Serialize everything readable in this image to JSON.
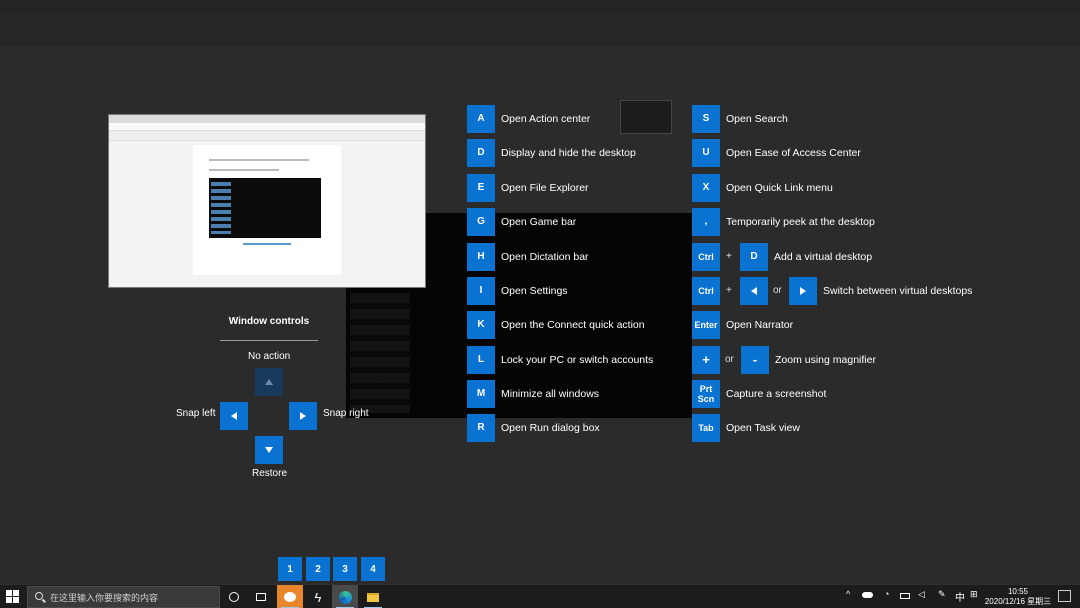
{
  "window_controls": {
    "title": "Window controls",
    "up_label": "No action",
    "left_label": "Snap left",
    "right_label": "Snap right",
    "down_label": "Restore"
  },
  "shortcuts_left": [
    {
      "key": "A",
      "desc": "Open Action center"
    },
    {
      "key": "D",
      "desc": "Display and hide the desktop"
    },
    {
      "key": "E",
      "desc": "Open File Explorer"
    },
    {
      "key": "G",
      "desc": "Open Game bar"
    },
    {
      "key": "H",
      "desc": "Open Dictation bar"
    },
    {
      "key": "I",
      "desc": "Open Settings"
    },
    {
      "key": "K",
      "desc": "Open the Connect quick action"
    },
    {
      "key": "L",
      "desc": "Lock your PC or switch accounts"
    },
    {
      "key": "M",
      "desc": "Minimize all windows"
    },
    {
      "key": "R",
      "desc": "Open Run dialog box"
    }
  ],
  "shortcuts_right": [
    {
      "key": "S",
      "desc": "Open Search"
    },
    {
      "key": "U",
      "desc": "Open Ease of Access Center"
    },
    {
      "key": "X",
      "desc": "Open Quick Link menu"
    },
    {
      "key": ",",
      "desc": "Temporarily peek at the desktop"
    },
    {
      "key": "Ctrl",
      "key2": "D",
      "plus": "+",
      "desc": "Add a virtual desktop"
    },
    {
      "key": "Ctrl",
      "plus": "+",
      "or": "or",
      "desc": "Switch between virtual desktops"
    },
    {
      "key": "Enter",
      "desc": "Open Narrator"
    },
    {
      "key": "+",
      "key2": "-",
      "or": "or",
      "desc": "Zoom using magnifier"
    },
    {
      "key": "Prt Scn",
      "desc": "Capture a screenshot"
    },
    {
      "key": "Tab",
      "desc": "Open Task view"
    }
  ],
  "app_badges": [
    "1",
    "2",
    "3",
    "4"
  ],
  "taskbar": {
    "search_placeholder": "在这里输入你要搜索的内容",
    "ime": "中",
    "time": "10:55",
    "date": "2020/12/16 星期三"
  },
  "colors": {
    "accent": "#0a72d0",
    "background": "#2a2a2a",
    "taskbar": "#1c1c1c"
  }
}
